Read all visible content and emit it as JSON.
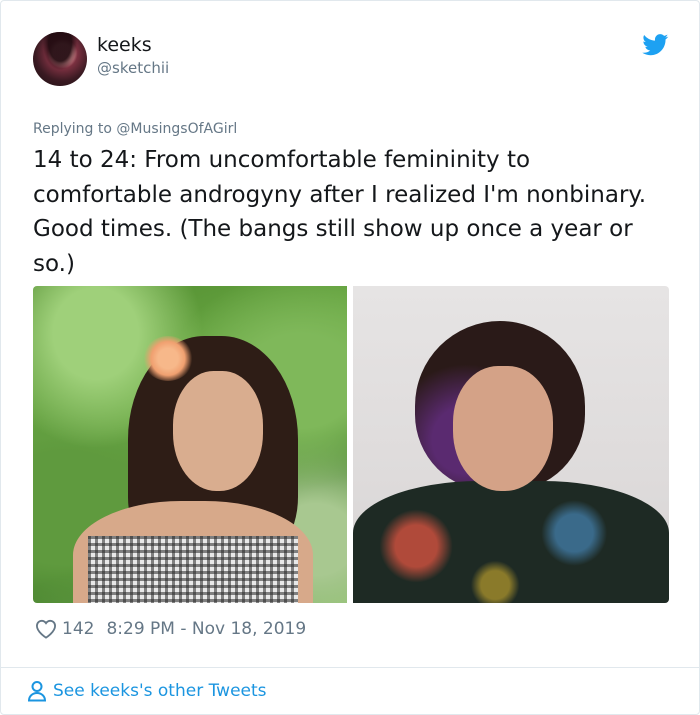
{
  "tweet": {
    "author_name": "keeks",
    "author_handle": "@sketchii",
    "reply_prefix": "Replying to ",
    "reply_to": "@MusingsOfAGirl",
    "text": "14 to 24: From uncomfortable femininity to comfortable androgyny after I realized I'm nonbinary. Good times. (The bangs still show up once a year or so.)",
    "like_count": "142",
    "timestamp": "8:29 PM - Nov 18, 2019"
  },
  "footer": {
    "more_tweets_label": "See keeks's other Tweets"
  },
  "icons": {
    "logo": "twitter-bird-icon",
    "like": "heart-icon",
    "profile": "person-icon"
  },
  "colors": {
    "brand": "#1da1f2",
    "link": "#1b95e0",
    "secondary_text": "#657786",
    "primary_text": "#14171a",
    "border": "#e1e8ed"
  }
}
